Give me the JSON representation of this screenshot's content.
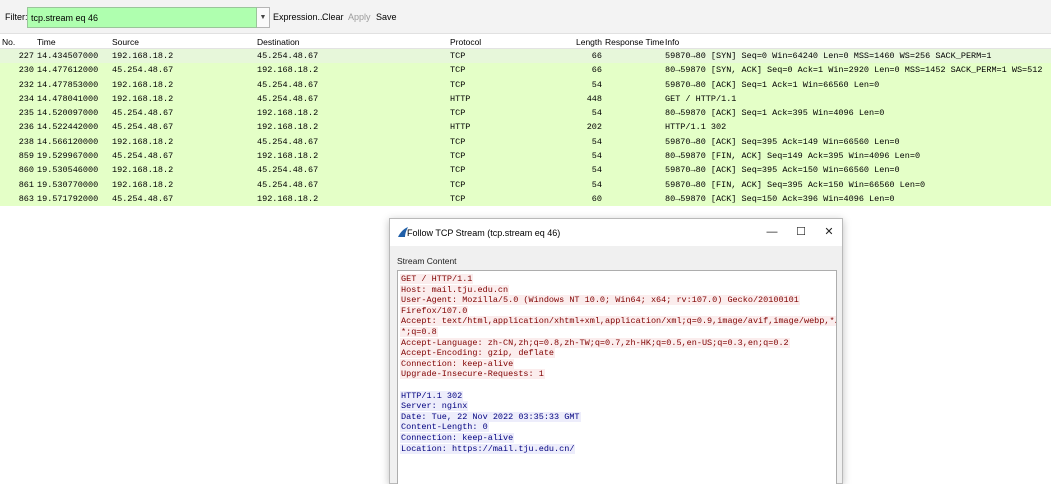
{
  "toolbar": {
    "filter_label": "Filter:",
    "filter_value": "tcp.stream eq 46",
    "expression_label": "Expression...",
    "clear_label": "Clear",
    "apply_label": "Apply",
    "save_label": "Save"
  },
  "packet_list": {
    "columns": {
      "no": "No.",
      "time": "Time",
      "source": "Source",
      "destination": "Destination",
      "protocol": "Protocol",
      "length": "Length",
      "response_time": "Response Time",
      "info": "Info"
    },
    "rows": [
      {
        "no": "227",
        "time": "14.434507000",
        "source": "192.168.18.2",
        "destination": "45.254.48.67",
        "protocol": "TCP",
        "length": "66",
        "info": "59870→80 [SYN] Seq=0 Win=64240 Len=0 MSS=1460 WS=256 SACK_PERM=1"
      },
      {
        "no": "230",
        "time": "14.477612000",
        "source": "45.254.48.67",
        "destination": "192.168.18.2",
        "protocol": "TCP",
        "length": "66",
        "info": "80→59870 [SYN, ACK] Seq=0 Ack=1 Win=2920 Len=0 MSS=1452 SACK_PERM=1 WS=512"
      },
      {
        "no": "232",
        "time": "14.477853000",
        "source": "192.168.18.2",
        "destination": "45.254.48.67",
        "protocol": "TCP",
        "length": "54",
        "info": "59870→80 [ACK] Seq=1 Ack=1 Win=66560 Len=0"
      },
      {
        "no": "234",
        "time": "14.478041000",
        "source": "192.168.18.2",
        "destination": "45.254.48.67",
        "protocol": "HTTP",
        "length": "448",
        "info": "GET / HTTP/1.1"
      },
      {
        "no": "235",
        "time": "14.520097000",
        "source": "45.254.48.67",
        "destination": "192.168.18.2",
        "protocol": "TCP",
        "length": "54",
        "info": "80→59870 [ACK] Seq=1 Ack=395 Win=4096 Len=0"
      },
      {
        "no": "236",
        "time": "14.522442000",
        "source": "45.254.48.67",
        "destination": "192.168.18.2",
        "protocol": "HTTP",
        "length": "202",
        "info": "HTTP/1.1 302"
      },
      {
        "no": "238",
        "time": "14.566120000",
        "source": "192.168.18.2",
        "destination": "45.254.48.67",
        "protocol": "TCP",
        "length": "54",
        "info": "59870→80 [ACK] Seq=395 Ack=149 Win=66560 Len=0"
      },
      {
        "no": "859",
        "time": "19.529967000",
        "source": "45.254.48.67",
        "destination": "192.168.18.2",
        "protocol": "TCP",
        "length": "54",
        "info": "80→59870 [FIN, ACK] Seq=149 Ack=395 Win=4096 Len=0"
      },
      {
        "no": "860",
        "time": "19.530546000",
        "source": "192.168.18.2",
        "destination": "45.254.48.67",
        "protocol": "TCP",
        "length": "54",
        "info": "59870→80 [ACK] Seq=395 Ack=150 Win=66560 Len=0"
      },
      {
        "no": "861",
        "time": "19.530770000",
        "source": "192.168.18.2",
        "destination": "45.254.48.67",
        "protocol": "TCP",
        "length": "54",
        "info": "59870→80 [FIN, ACK] Seq=395 Ack=150 Win=66560 Len=0"
      },
      {
        "no": "863",
        "time": "19.571792000",
        "source": "45.254.48.67",
        "destination": "192.168.18.2",
        "protocol": "TCP",
        "length": "60",
        "info": "80→59870 [ACK] Seq=150 Ack=396 Win=4096 Len=0"
      }
    ]
  },
  "dialog": {
    "title": "Follow TCP Stream (tcp.stream eq 46)",
    "icon": "wireshark-fin-icon",
    "minimize_glyph": "—",
    "maximize_glyph": "☐",
    "close_glyph": "✕",
    "stream_label": "Stream Content",
    "client_color": "#7f0000",
    "server_color": "#00007f",
    "client_lines": [
      "GET / HTTP/1.1",
      "Host: mail.tju.edu.cn",
      "User-Agent: Mozilla/5.0 (Windows NT 10.0; Win64; x64; rv:107.0) Gecko/20100101",
      "Firefox/107.0",
      "Accept: text/html,application/xhtml+xml,application/xml;q=0.9,image/avif,image/webp,*/",
      "*;q=0.8",
      "Accept-Language: zh-CN,zh;q=0.8,zh-TW;q=0.7,zh-HK;q=0.5,en-US;q=0.3,en;q=0.2",
      "Accept-Encoding: gzip, deflate",
      "Connection: keep-alive",
      "Upgrade-Insecure-Requests: 1"
    ],
    "server_lines": [
      "HTTP/1.1 302",
      "Server: nginx",
      "Date: Tue, 22 Nov 2022 03:35:33 GMT",
      "Content-Length: 0",
      "Connection: keep-alive",
      "Location: https://mail.tju.edu.cn/"
    ]
  }
}
